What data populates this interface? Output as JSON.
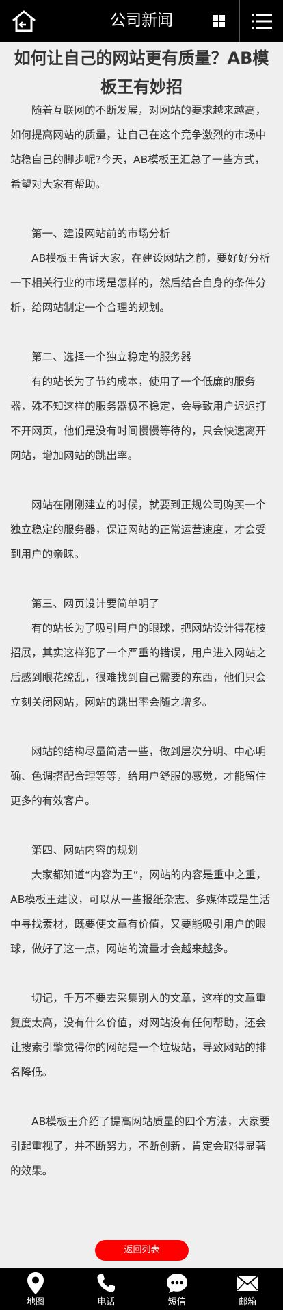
{
  "header": {
    "title": "公司新闻",
    "back_icon": "home-back-icon",
    "grid_icon": "grid-icon",
    "menu_icon": "menu-icon"
  },
  "article": {
    "title": "如何让自己的网站更有质量？AB模板王有妙招",
    "paragraphs": [
      "随着互联网的不断发展，对网站的要求越来越高，如何提高网站的质量，让自己在这个竞争激烈的市场中站稳自己的脚步呢?今天，AB模板王汇总了一些方式，希望对大家有帮助。",
      "",
      "第一、建设网站前的市场分析",
      "AB模板王告诉大家，在建设网站之前，要好好分析一下相关行业的市场是怎样的，然后结合自身的条件分析，给网站制定一个合理的规划。",
      "",
      "第二、选择一个独立稳定的服务器",
      "有的站长为了节约成本，使用了一个低廉的服务器，殊不知这样的服务器极不稳定，会导致用户迟迟打不开网页，他们是没有时间慢慢等待的，只会快速离开网站，增加网站的跳出率。",
      "",
      "网站在刚刚建立的时候，就要到正规公司购买一个独立稳定的服务器，保证网站的正常运营速度，才会受到用户的亲睐。",
      "",
      "第三、网页设计要简单明了",
      "有的站长为了吸引用户的眼球，把网站设计得花枝招展，其实这样犯了一个严重的错误，用户进入网站之后感到眼花缭乱，很难找到自己需要的东西，他们只会立刻关闭网站，网站的跳出率会随之增多。",
      "",
      "网站的结构尽量简洁一些，做到层次分明、中心明确、色调搭配合理等等，给用户舒服的感觉，才能留住更多的有效客户。",
      "",
      "第四、网站内容的规划",
      "大家都知道“内容为王”，网站的内容是重中之重，AB模板王建议，可以从一些报纸杂志、多媒体或是生活中寻找素材，既要使文章有价值，又要能吸引用户的眼球，做好了这一点，网站的流量才会越来越多。",
      "",
      "切记，千万不要去采集别人的文章，这样的文章重复度太高，没有什么价值，对网站没有任何帮助，还会让搜索引擎觉得你的网站是一个垃圾站，导致网站的排名降低。",
      "",
      "AB模板王介绍了提高网站质量的四个方法，大家要引起重视了，并不断努力，不断创新，肯定会取得显著的效果。"
    ]
  },
  "back_button": {
    "label": "返回列表",
    "color": "#ff0000"
  },
  "footer": {
    "items": [
      {
        "label": "地图",
        "icon": "map-pin-icon"
      },
      {
        "label": "电话",
        "icon": "phone-icon"
      },
      {
        "label": "短信",
        "icon": "sms-icon"
      },
      {
        "label": "邮箱",
        "icon": "mail-icon"
      }
    ]
  }
}
